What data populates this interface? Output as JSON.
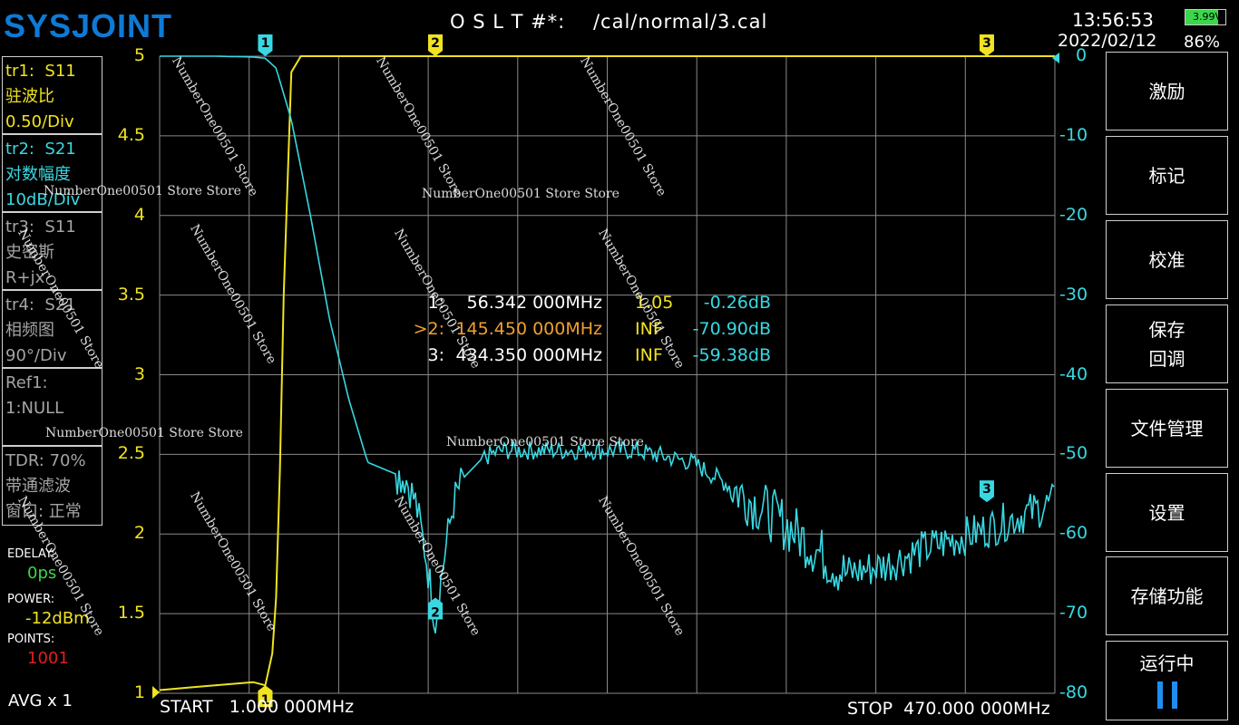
{
  "header": {
    "logo": "SYSJOINT",
    "title": "O S L T #*:    /cal/normal/3.cal",
    "time": "13:56:53",
    "date": "2022/02/12",
    "battery_voltage": "3.99V",
    "battery_percent": "86%"
  },
  "traces": [
    {
      "id": "tr1",
      "line1": "tr1:  S11",
      "line2": "驻波比",
      "line3": "0.50/Div",
      "color": "#f0e320"
    },
    {
      "id": "tr2",
      "line1": "tr2:  S21",
      "line2": "对数幅度",
      "line3": "10dB/Div",
      "color": "#38d8e2"
    },
    {
      "id": "tr3",
      "line1": "tr3:  S11",
      "line2": "史密斯",
      "line3": "R+jx",
      "color": "#a4a4a4"
    },
    {
      "id": "tr4",
      "line1": "tr4:  S21",
      "line2": "相频图",
      "line3": "90°/Div",
      "color": "#a4a4a4"
    }
  ],
  "ref_box": {
    "line1": "Ref1:",
    "line2": "1:NULL"
  },
  "tdr_box": {
    "line1": "TDR: 70%",
    "line2": "带通滤波",
    "line3": "窗口: 正常"
  },
  "settings": {
    "edelay_label": "EDELAY:",
    "edelay_value": "0ps",
    "power_label": "POWER:",
    "power_value": "-12dBm",
    "points_label": "POINTS:",
    "points_value": "1001",
    "avg": "AVG x 1"
  },
  "axis": {
    "left_ticks": [
      "5",
      "4.5",
      "4",
      "3.5",
      "3",
      "2.5",
      "2",
      "1.5",
      "1"
    ],
    "right_ticks": [
      "0",
      "-10",
      "-20",
      "-30",
      "-40",
      "-50",
      "-60",
      "-70",
      "-80"
    ],
    "start_label": "START   1.000 000MHz",
    "stop_label": "STOP  470.000 000MHz"
  },
  "markers_table": [
    {
      "num": "1:",
      "freq": "56.342 000MHz",
      "swr": "1.05",
      "db": "-0.26dB",
      "num_color": "#ffffff",
      "freq_color": "#ffffff"
    },
    {
      "num": ">2:",
      "freq": "145.450 000MHz",
      "swr": "INF",
      "db": "-70.90dB",
      "num_color": "#f0a030",
      "freq_color": "#f0a030"
    },
    {
      "num": "3:",
      "freq": "434.350 000MHz",
      "swr": "INF",
      "db": "-59.38dB",
      "num_color": "#ffffff",
      "freq_color": "#ffffff"
    }
  ],
  "marker_flags": {
    "m1": "1",
    "m2": "2",
    "m3": "3"
  },
  "menu": [
    {
      "label": "激励"
    },
    {
      "label": "标记"
    },
    {
      "label": "校准"
    },
    {
      "label": "保存\n回调"
    },
    {
      "label": "文件管理"
    },
    {
      "label": "设置"
    },
    {
      "label": "存储功能"
    },
    {
      "label": "运行中"
    }
  ],
  "watermark": {
    "text_a": "NumberOne00501 Store Store",
    "text_b": "NumberOne00501  Store"
  },
  "chart_data": {
    "type": "line",
    "x_range_mhz": [
      1,
      470
    ],
    "series": [
      {
        "name": "S11",
        "y_axis": "left",
        "ylim": [
          1,
          5
        ],
        "color": "#f0e320",
        "x": [
          1,
          20,
          40,
          50,
          56.342,
          60,
          62,
          64,
          66,
          70,
          75,
          80,
          100,
          145.45,
          200,
          300,
          434.35,
          470
        ],
        "y": [
          1.02,
          1.04,
          1.06,
          1.07,
          1.05,
          1.25,
          1.6,
          2.4,
          3.5,
          4.9,
          5,
          5,
          5,
          5,
          5,
          5,
          5,
          5
        ]
      },
      {
        "name": "S21",
        "y_axis": "right",
        "ylim": [
          -80,
          0
        ],
        "color": "#38d8e2",
        "x": [
          1,
          30,
          50,
          56.342,
          62,
          70,
          80,
          90,
          100,
          110,
          120,
          130,
          135,
          140,
          145.45,
          150,
          155,
          160,
          170,
          180,
          200,
          250,
          280,
          300,
          330,
          360,
          380,
          400,
          434.35,
          470
        ],
        "y": [
          0,
          0,
          -0.1,
          -0.26,
          -1.5,
          -8,
          -20,
          -33,
          -43,
          -51,
          -52,
          -53,
          -56,
          -62,
          -70.9,
          -63,
          -56,
          -53,
          -50.5,
          -49.5,
          -49.5,
          -49.5,
          -51,
          -54,
          -59,
          -65,
          -64,
          -62,
          -59.38,
          -56
        ]
      }
    ]
  }
}
